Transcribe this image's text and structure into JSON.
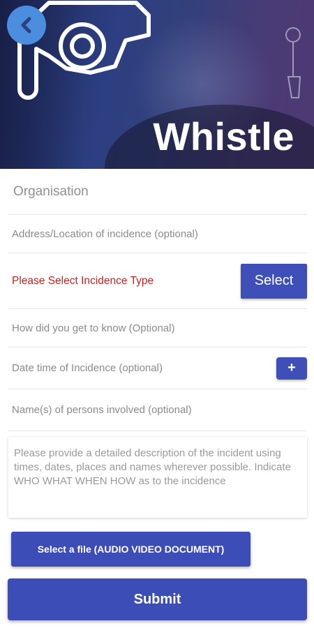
{
  "header": {
    "brand_title": "Whistle",
    "back_icon": "chevron-left-icon",
    "logo_icon": "whistle-icon"
  },
  "form": {
    "organisation_placeholder": "Organisation",
    "address_placeholder": "Address/Location of incidence (optional)",
    "incidence_type_prompt": "Please Select Incidence Type",
    "select_button_label": "Select",
    "how_known_placeholder": "How did you get to know (Optional)",
    "date_time_placeholder": "Date time of Incidence (optional)",
    "date_add_label": "+",
    "persons_placeholder": "Name(s) of persons involved (optional)",
    "description_placeholder": "Please provide a detailed description of the incident using times, dates, places and names wherever possible. Indicate WHO WHAT WHEN HOW as to the incidence",
    "file_button_label": "Select a file (AUDIO VIDEO DOCUMENT)",
    "submit_button_label": "Submit"
  },
  "colors": {
    "accent": "#3f4fb8",
    "error_text": "#cc1f1f",
    "back_button": "#4b8ee0"
  }
}
